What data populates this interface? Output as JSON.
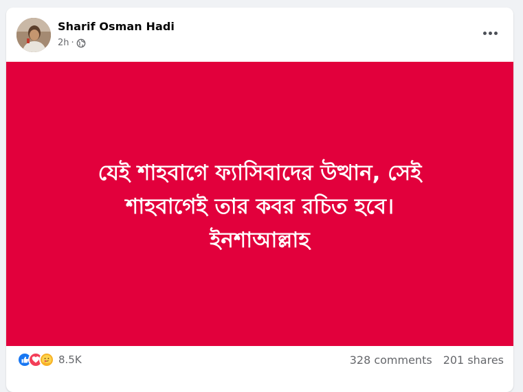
{
  "post": {
    "author": "Sharif Osman Hadi",
    "time": "2h",
    "separator": "·",
    "text_lines": [
      "যেই শাহবাগে ফ্যাসিবাদের উত্থান, সেই",
      "শাহবাগেই তার কবর রচিত হবে।",
      "ইনশাআল্লাহ"
    ],
    "background_color": "#e2003c"
  },
  "engagement": {
    "reactions": [
      "like-icon",
      "love-icon",
      "care-icon"
    ],
    "reaction_count": "8.5K",
    "comments": "328 comments",
    "shares": "201 shares"
  },
  "icons": {
    "more": "more-options-icon",
    "audience": "globe-icon"
  },
  "colors": {
    "like": "#1877f2",
    "love": "#f33e58",
    "care": "#f7b125"
  }
}
